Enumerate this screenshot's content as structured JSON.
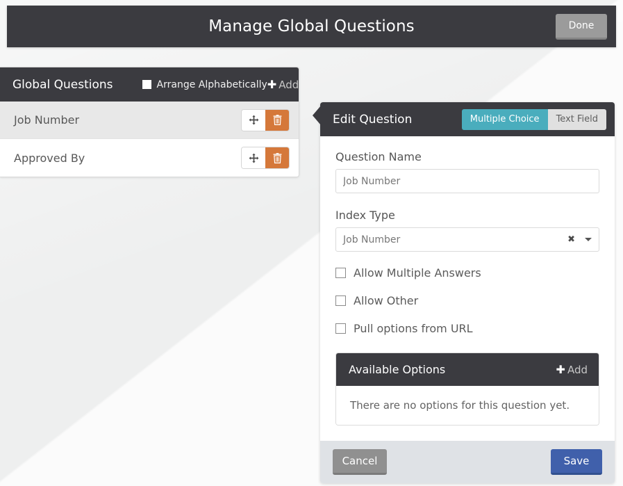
{
  "header": {
    "title": "Manage Global Questions",
    "done_label": "Done"
  },
  "left_panel": {
    "title": "Global Questions",
    "arrange_alphabetically_label": "Arrange Alphabetically",
    "arrange_alphabetically_checked": false,
    "add_label": "Add",
    "plus_glyph": "✚",
    "questions": [
      {
        "label": "Job Number",
        "selected": true
      },
      {
        "label": "Approved By",
        "selected": false
      }
    ],
    "row_icons": {
      "move": "move-icon",
      "delete": "trash-icon"
    }
  },
  "edit_panel": {
    "title": "Edit Question",
    "type_toggle": {
      "options": [
        "Multiple Choice",
        "Text Field"
      ],
      "selected": "Multiple Choice"
    },
    "question_name": {
      "label": "Question Name",
      "value": "Job Number"
    },
    "index_type": {
      "label": "Index Type",
      "value": "Job Number",
      "clear_glyph": "✖"
    },
    "checkboxes": [
      {
        "label": "Allow Multiple Answers",
        "checked": false
      },
      {
        "label": "Allow Other",
        "checked": false
      },
      {
        "label": "Pull options from URL",
        "checked": false
      }
    ],
    "available_options": {
      "title": "Available Options",
      "add_label": "Add",
      "plus_glyph": "✚",
      "empty_message": "There are no options for this question yet."
    },
    "footer": {
      "cancel_label": "Cancel",
      "save_label": "Save"
    }
  },
  "colors": {
    "dark_header": "#3b3b40",
    "teal_accent": "#4aadbd",
    "orange_delete": "#d5783a",
    "blue_save": "#4060ab",
    "gray_button": "#9b9b9b"
  }
}
